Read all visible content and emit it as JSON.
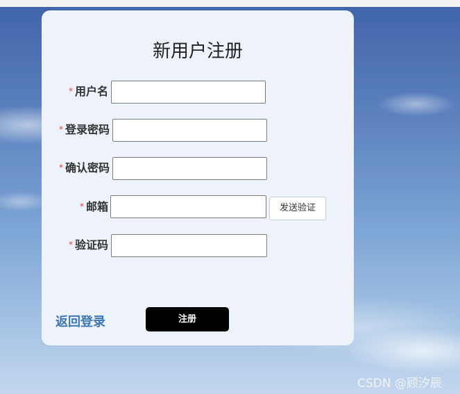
{
  "form": {
    "title": "新用户注册",
    "required_mark": "*",
    "fields": [
      {
        "label": "用户名",
        "value": ""
      },
      {
        "label": "登录密码",
        "value": ""
      },
      {
        "label": "确认密码",
        "value": ""
      },
      {
        "label": "邮箱",
        "value": ""
      },
      {
        "label": "验证码",
        "value": ""
      }
    ],
    "send_code_label": "发送验证",
    "back_label": "返回登录",
    "register_label": "注册"
  },
  "watermark": "CSDN @顾汐辰"
}
